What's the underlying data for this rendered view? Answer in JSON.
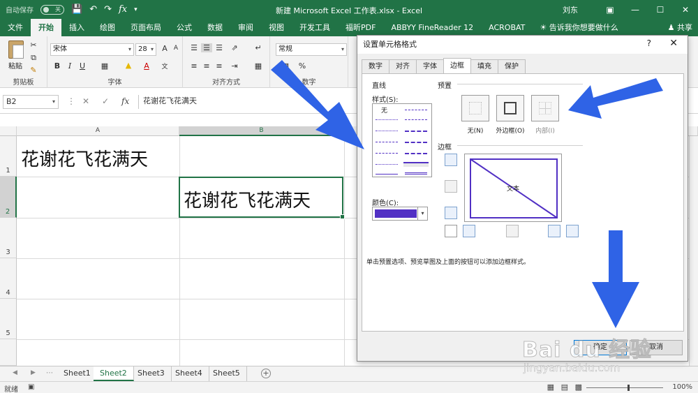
{
  "titlebar": {
    "autosave_label": "自动保存",
    "autosave_state": "关",
    "doc_title": "新建 Microsoft Excel 工作表.xlsx  -  Excel",
    "user": "刘东",
    "fx": "fx"
  },
  "ribbon_tabs": [
    "文件",
    "开始",
    "插入",
    "绘图",
    "页面布局",
    "公式",
    "数据",
    "审阅",
    "视图",
    "开发工具",
    "福昕PDF",
    "ABBYY FineReader 12",
    "ACROBAT"
  ],
  "active_tab": "开始",
  "tellme": "告诉我你想要做什么",
  "share": "共享",
  "ribbon": {
    "paste_label": "粘贴",
    "clipboard_label": "剪贴板",
    "font_label": "字体",
    "align_label": "对齐方式",
    "number_label": "数字",
    "font_name": "宋体",
    "font_size": "28",
    "number_format": "常规",
    "bold": "B",
    "italic": "I",
    "underline": "U",
    "grow": "A",
    "shrink": "A",
    "percent": "%"
  },
  "formula_bar": {
    "name_box": "B2",
    "value": "花谢花飞花满天"
  },
  "grid": {
    "columns": [
      "A",
      "B"
    ],
    "rows": [
      "1",
      "2",
      "3",
      "4",
      "5"
    ],
    "cell_a1": "花谢花飞花满天",
    "cell_b2": "花谢花飞花满天"
  },
  "sheets": [
    "Sheet1",
    "Sheet2",
    "Sheet3",
    "Sheet4",
    "Sheet5"
  ],
  "active_sheet": "Sheet2",
  "status": {
    "ready": "就绪",
    "zoom": "100%"
  },
  "dialog": {
    "title": "设置单元格格式",
    "help": "?",
    "tabs": [
      "数字",
      "对齐",
      "字体",
      "边框",
      "填充",
      "保护"
    ],
    "active_tab": "边框",
    "line_section": "直线",
    "style_label": "样式(S):",
    "style_none": "无",
    "color_label": "颜色(C):",
    "border_color": "#5130c4",
    "presets_section": "预置",
    "preset_none": "无(N)",
    "preset_outline": "外边框(O)",
    "preset_inside": "内部(I)",
    "border_section": "边框",
    "preview_text": "文本",
    "hint": "单击预置选项、预览草图及上面的按钮可以添加边框样式。",
    "ok": "确定",
    "cancel": "取消"
  },
  "watermark": {
    "brand": "Bai du 经验",
    "url": "jingyan.baidu.com"
  },
  "colors": {
    "excel_green": "#217346",
    "arrow_blue": "#2f63e6"
  }
}
